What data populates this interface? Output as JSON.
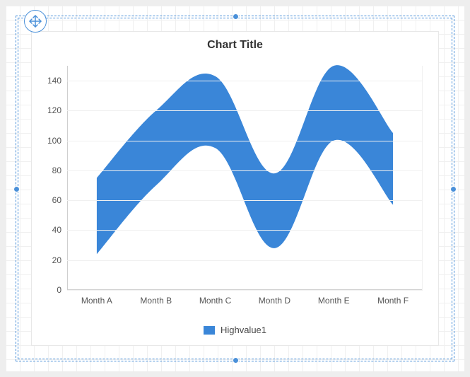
{
  "title": "Chart Title",
  "legend": {
    "label": "Highvalue1"
  },
  "colors": {
    "series": "#3a86d8",
    "selection": "#4a90d9",
    "grid": "#f0f0f0",
    "axis": "#cfcfcf"
  },
  "chart_data": {
    "type": "area",
    "title": "Chart Title",
    "xlabel": "",
    "ylabel": "",
    "ylim": [
      0,
      150
    ],
    "yticks": [
      0,
      20,
      40,
      60,
      80,
      100,
      120,
      140
    ],
    "categories": [
      "Month A",
      "Month B",
      "Month C",
      "Month D",
      "Month E",
      "Month F"
    ],
    "series": [
      {
        "name": "Highvalue1",
        "high": [
          75,
          120,
          143,
          78,
          150,
          105
        ],
        "low": [
          24,
          70,
          95,
          28,
          100,
          57
        ]
      }
    ],
    "legend_position": "bottom",
    "grid": true,
    "smooth": true
  }
}
